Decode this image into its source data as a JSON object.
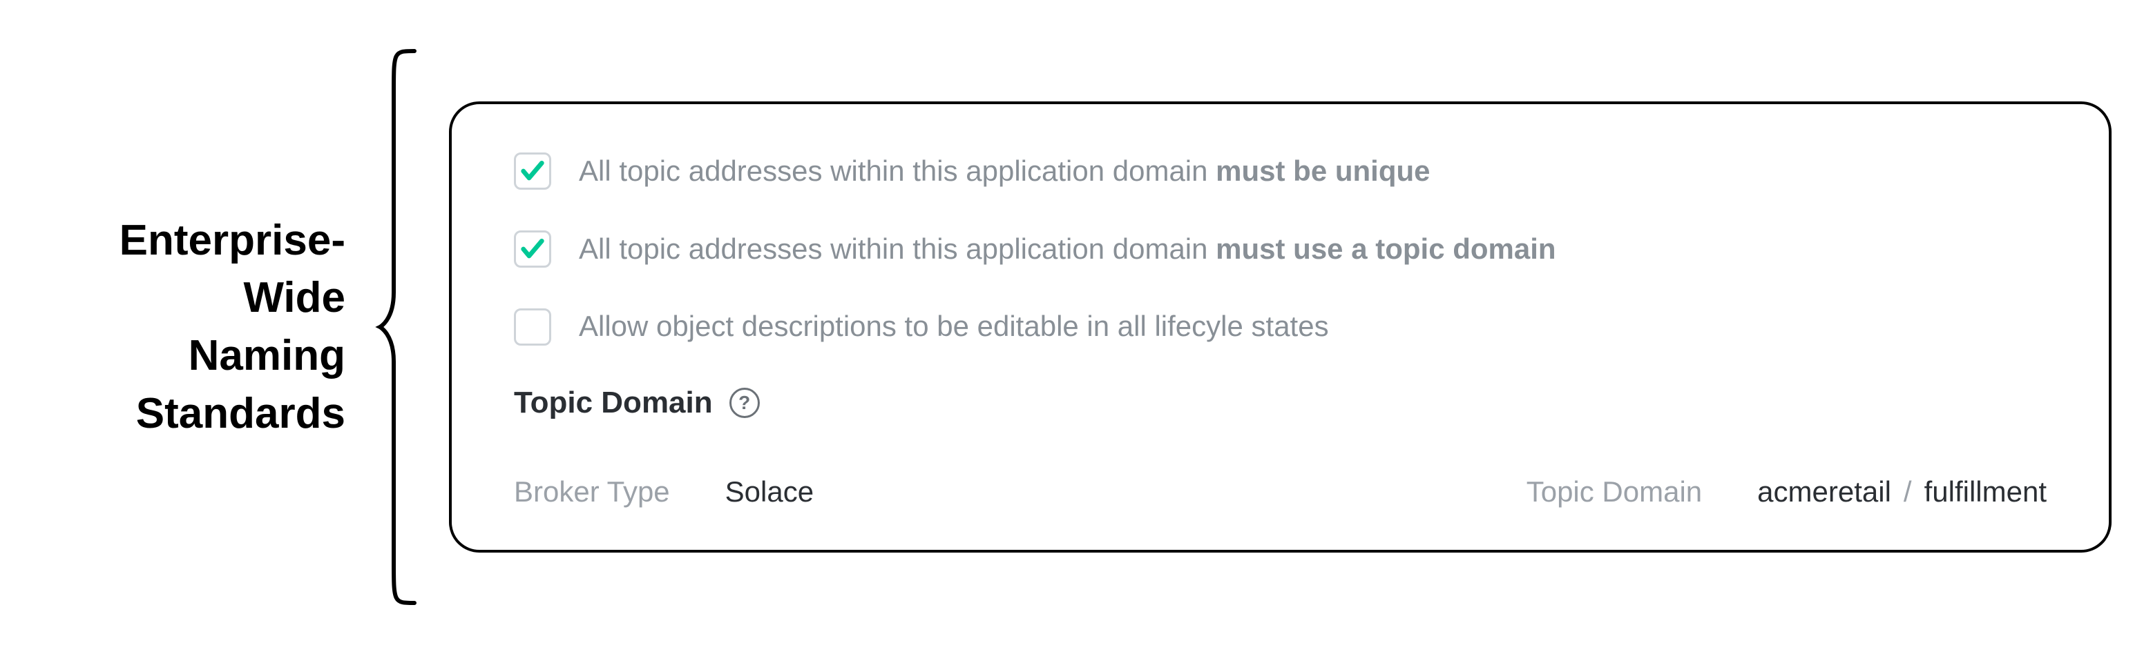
{
  "annotation": {
    "line1": "Enterprise-",
    "line2": "Wide",
    "line3": "Naming",
    "line4": "Standards"
  },
  "checkboxes": [
    {
      "checked": true,
      "lead": "All topic addresses within this application domain ",
      "bold": "must be unique"
    },
    {
      "checked": true,
      "lead": "All topic addresses within this application domain ",
      "bold": "must use a topic domain"
    },
    {
      "checked": false,
      "lead": "Allow object descriptions to be editable in all lifecyle states",
      "bold": ""
    }
  ],
  "section": {
    "title": "Topic Domain",
    "help_glyph": "?"
  },
  "broker": {
    "label": "Broker Type",
    "value": "Solace"
  },
  "topic_domain": {
    "label": "Topic Domain",
    "seg1": "acmeretail",
    "sep": "/",
    "seg2": "fulfillment"
  },
  "colors": {
    "check": "#00C895"
  }
}
